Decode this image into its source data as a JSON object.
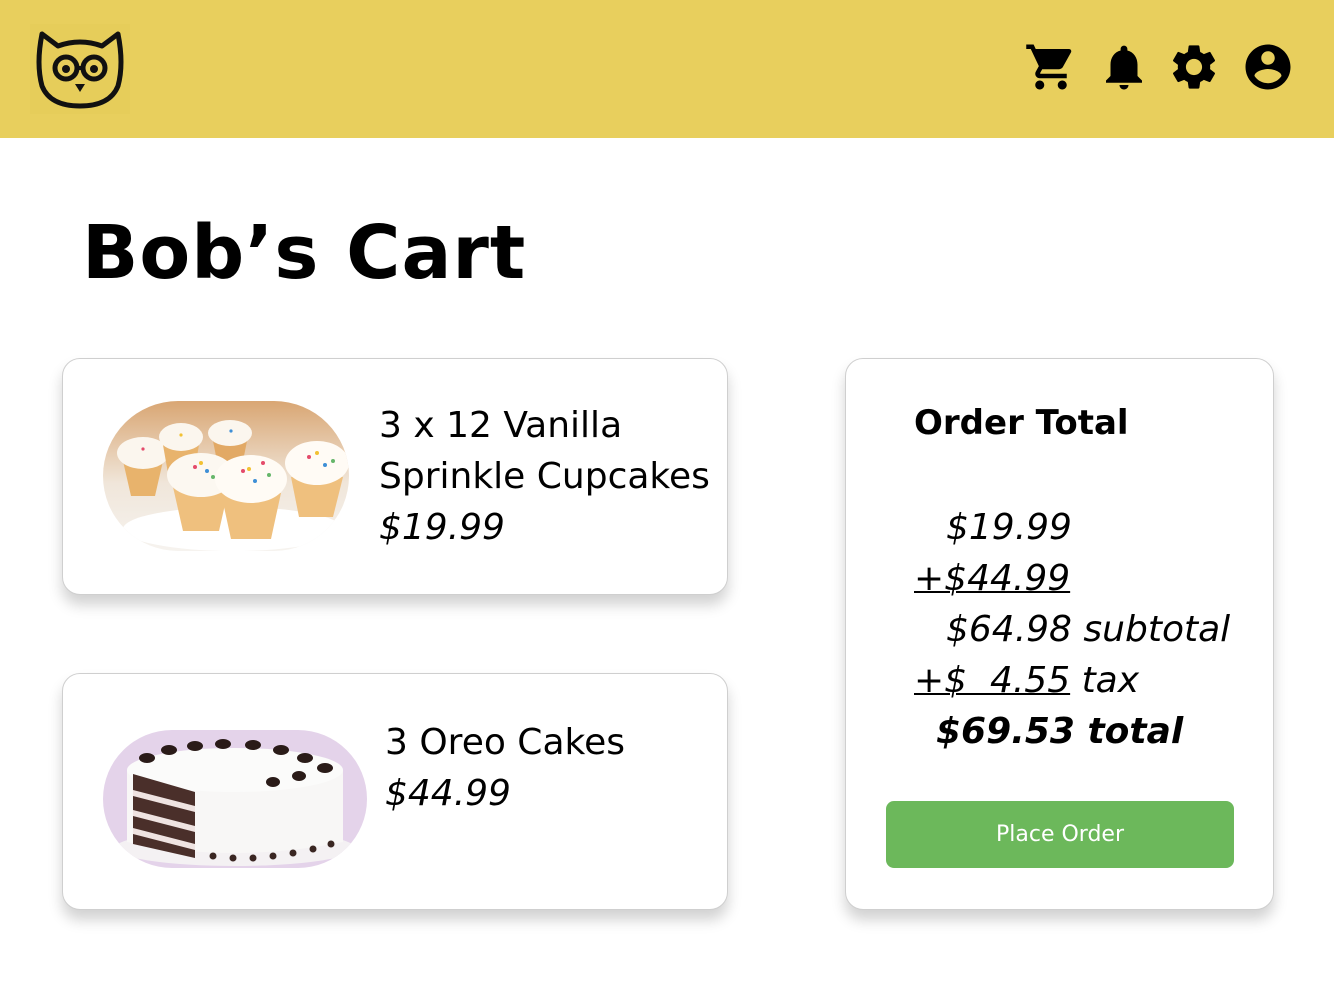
{
  "header": {
    "logo_icon": "owl-logo-icon",
    "nav": [
      {
        "icon": "cart-icon"
      },
      {
        "icon": "bell-icon"
      },
      {
        "icon": "gear-icon"
      },
      {
        "icon": "account-icon"
      }
    ],
    "background": "#e8cf5d"
  },
  "page": {
    "title": "Bob’s Cart"
  },
  "cart": {
    "items": [
      {
        "name_line1": "3 x 12 Vanilla",
        "name_line2": "Sprinkle Cupcakes",
        "price": "$19.99",
        "image": "vanilla-sprinkle-cupcakes-image"
      },
      {
        "name_line1": "3 Oreo Cakes",
        "price": "$44.99",
        "image": "oreo-cake-image"
      }
    ]
  },
  "order_total": {
    "title": "Order Total",
    "line1": "$19.99",
    "line2": "+$44.99",
    "line3": "$64.98 subtotal",
    "line4_amount": "+$  4.55",
    "line4_label": " tax",
    "line5": "$69.53 total",
    "button_label": "Place Order",
    "button_color": "#6cb85b"
  }
}
